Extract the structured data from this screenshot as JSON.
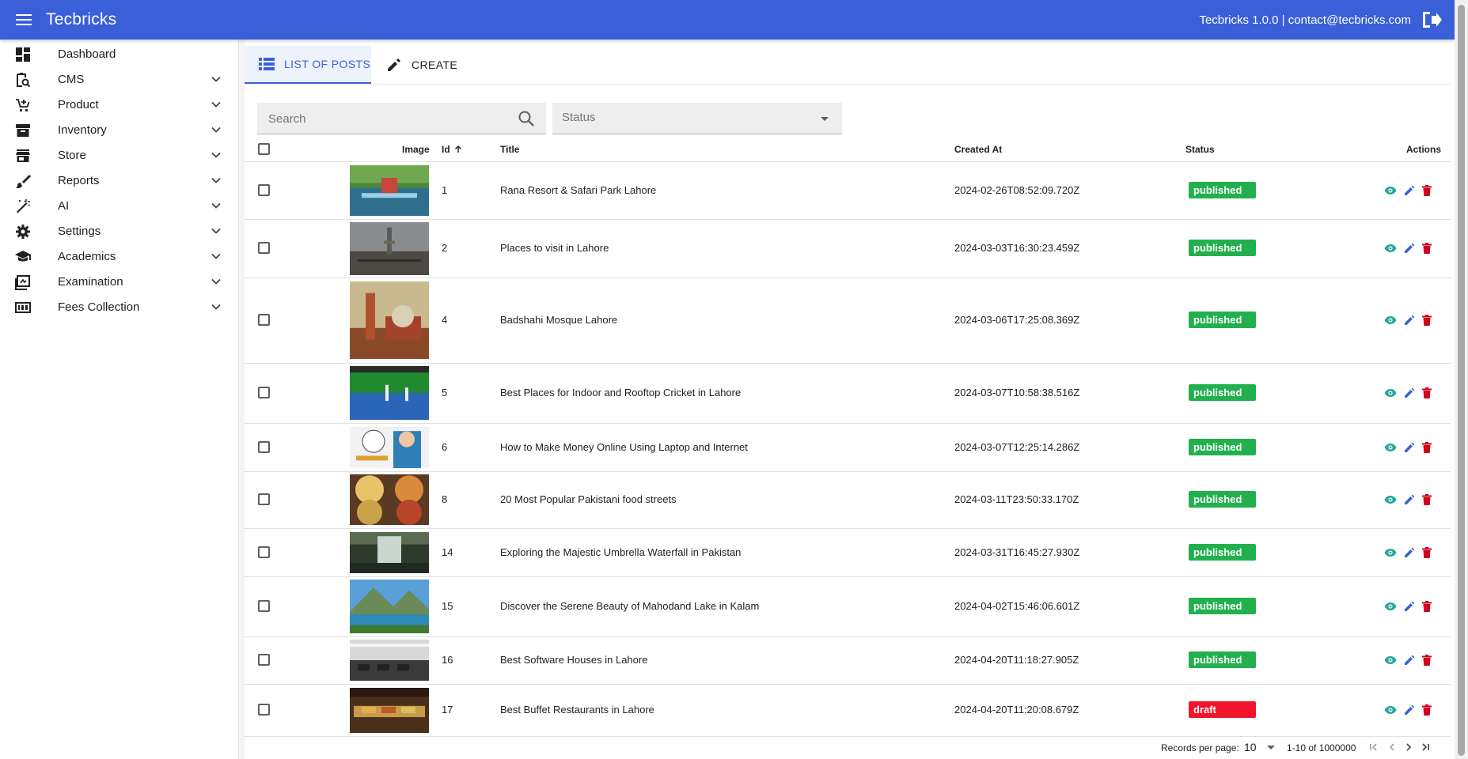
{
  "app": {
    "title": "Tecbricks",
    "info": "Tecbricks 1.0.0 | contact@tecbricks.com"
  },
  "sidebar": {
    "items": [
      {
        "label": "Dashboard",
        "icon": "dashboard-icon",
        "expandable": false
      },
      {
        "label": "CMS",
        "icon": "content-search-icon",
        "expandable": true
      },
      {
        "label": "Product",
        "icon": "cart-add-icon",
        "expandable": true
      },
      {
        "label": "Inventory",
        "icon": "archive-icon",
        "expandable": true
      },
      {
        "label": "Store",
        "icon": "store-icon",
        "expandable": true
      },
      {
        "label": "Reports",
        "icon": "brush-icon",
        "expandable": true
      },
      {
        "label": "AI",
        "icon": "magic-wand-icon",
        "expandable": true
      },
      {
        "label": "Settings",
        "icon": "gear-icon",
        "expandable": true
      },
      {
        "label": "Academics",
        "icon": "school-icon",
        "expandable": true
      },
      {
        "label": "Examination",
        "icon": "quiz-icon",
        "expandable": true
      },
      {
        "label": "Fees Collection",
        "icon": "counter-icon",
        "expandable": true
      }
    ]
  },
  "tabs": {
    "list_label": "LIST OF POSTS",
    "create_label": "CREATE"
  },
  "filters": {
    "search_placeholder": "Search",
    "status_placeholder": "Status"
  },
  "table": {
    "headers": {
      "image": "Image",
      "id": "Id",
      "title": "Title",
      "created_at": "Created At",
      "status": "Status",
      "actions": "Actions"
    },
    "rows": [
      {
        "id": "1",
        "title": "Rana Resort & Safari Park Lahore",
        "created_at": "2024-02-26T08:52:09.720Z",
        "status": "published",
        "image": "resort-lake-photo"
      },
      {
        "id": "2",
        "title": "Places to visit in Lahore",
        "created_at": "2024-03-03T16:30:23.459Z",
        "status": "published",
        "image": "minar-city-photo"
      },
      {
        "id": "4",
        "title": "Badshahi Mosque Lahore",
        "created_at": "2024-03-06T17:25:08.369Z",
        "status": "published",
        "image": "mosque-painting-photo"
      },
      {
        "id": "5",
        "title": "Best Places for Indoor and Rooftop Cricket in Lahore",
        "created_at": "2024-03-07T10:58:38.516Z",
        "status": "published",
        "image": "indoor-cricket-photo"
      },
      {
        "id": "6",
        "title": "How to Make Money Online Using Laptop and Internet",
        "created_at": "2024-03-07T12:25:14.286Z",
        "status": "published",
        "image": "make-money-photo"
      },
      {
        "id": "8",
        "title": "20 Most Popular Pakistani food streets",
        "created_at": "2024-03-11T23:50:33.170Z",
        "status": "published",
        "image": "food-plates-photo"
      },
      {
        "id": "14",
        "title": "Exploring the Majestic Umbrella Waterfall in Pakistan",
        "created_at": "2024-03-31T16:45:27.930Z",
        "status": "published",
        "image": "waterfall-photo"
      },
      {
        "id": "15",
        "title": "Discover the Serene Beauty of Mahodand Lake in Kalam",
        "created_at": "2024-04-02T15:46:06.601Z",
        "status": "published",
        "image": "mountain-lake-photo"
      },
      {
        "id": "16",
        "title": "Best Software Houses in Lahore",
        "created_at": "2024-04-20T11:18:27.905Z",
        "status": "published",
        "image": "office-hall-photo"
      },
      {
        "id": "17",
        "title": "Best Buffet Restaurants in Lahore",
        "created_at": "2024-04-20T11:20:08.679Z",
        "status": "draft",
        "image": "buffet-photo"
      }
    ]
  },
  "pagination": {
    "records_per_page_label": "Records per page:",
    "records_per_page": "10",
    "range": "1-10 of 1000000"
  },
  "colors": {
    "primary": "#3a5fd9",
    "published": "#22b04e",
    "draft": "#f0142c",
    "view": "#26a69a",
    "edit": "#3a5fd9",
    "delete": "#d0021b"
  }
}
